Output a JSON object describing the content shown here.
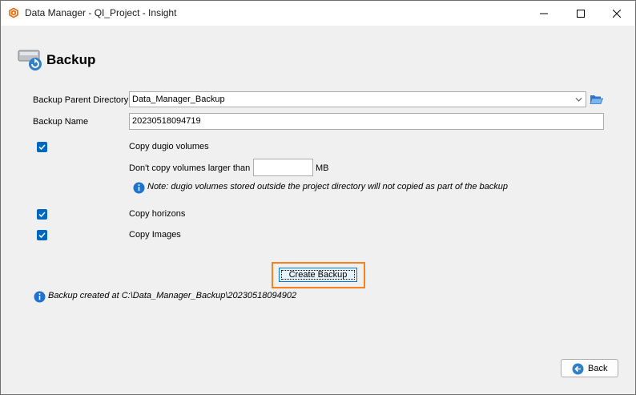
{
  "window": {
    "title": "Data Manager - QI_Project - Insight"
  },
  "header": {
    "title": "Backup"
  },
  "form": {
    "parent_dir_label": "Backup Parent Directory",
    "parent_dir_value": "Data_Manager_Backup",
    "name_label": "Backup Name",
    "name_value": "20230518094719",
    "copy_volumes_label": "Copy dugio volumes",
    "copy_volumes_checked": true,
    "size_limit_label": "Don't copy volumes larger than",
    "size_limit_value": "",
    "size_limit_unit": "MB",
    "volumes_note": "Note: dugio volumes stored outside the project directory will not copied as part of the backup",
    "copy_horizons_label": "Copy horizons",
    "copy_horizons_checked": true,
    "copy_images_label": "Copy Images",
    "copy_images_checked": true
  },
  "actions": {
    "create_label": "Create Backup",
    "back_label": "Back"
  },
  "status": {
    "message": "Backup created at C:\\Data_Manager_Backup\\20230518094902"
  },
  "colors": {
    "accent": "#0067c0",
    "highlight": "#f5821f"
  },
  "icons": [
    "app-logo-icon",
    "minimize-icon",
    "maximize-icon",
    "close-icon",
    "backup-drive-icon",
    "chevron-down-icon",
    "folder-open-icon",
    "info-icon",
    "back-arrow-icon",
    "checkmark-icon"
  ]
}
